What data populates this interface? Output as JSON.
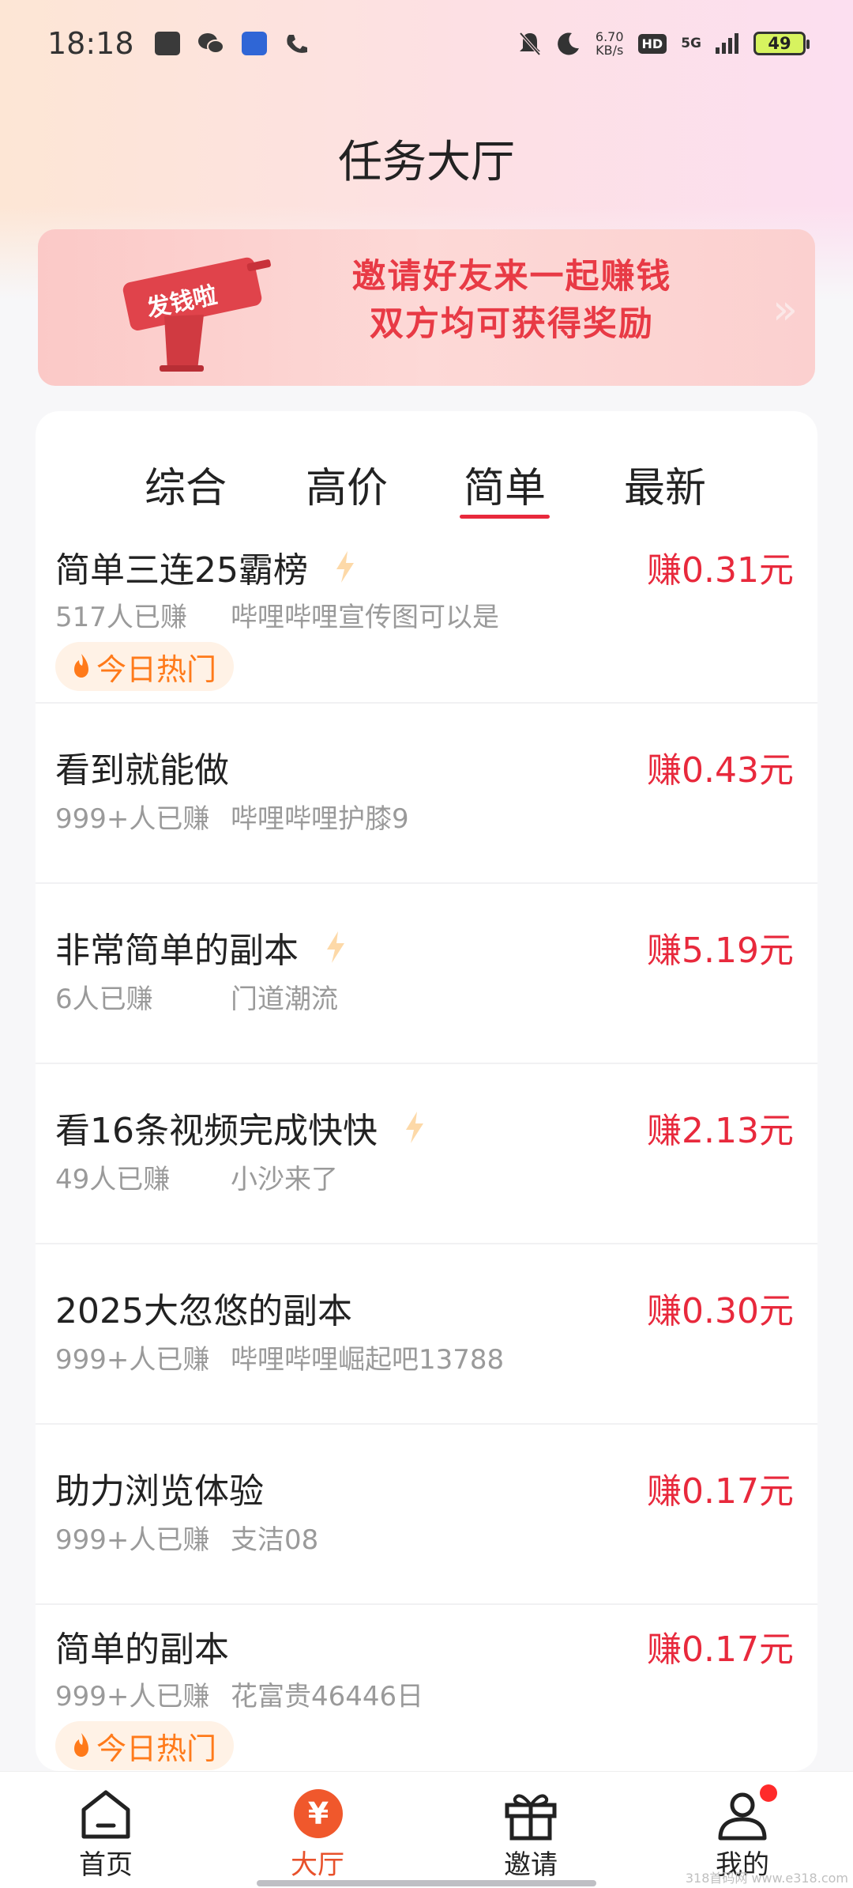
{
  "status_bar": {
    "time": "18:18",
    "net_speed_value": "6.70",
    "net_speed_unit": "KB/s",
    "hd": "HD",
    "network": "5G",
    "battery": "49",
    "icons": [
      "calendar-icon",
      "wechat-icon",
      "baidu-icon",
      "missed-call-icon",
      "mute-icon",
      "moon-icon",
      "signal-icon"
    ]
  },
  "header": {
    "title": "任务大厅"
  },
  "banner": {
    "badge": "发钱啦",
    "line1": "邀请好友来一起赚钱",
    "line2": "双方均可获得奖励",
    "arrow": "»"
  },
  "tabs": [
    {
      "label": "综合",
      "active": false
    },
    {
      "label": "高价",
      "active": false
    },
    {
      "label": "简单",
      "active": true
    },
    {
      "label": "最新",
      "active": false
    }
  ],
  "tasks": [
    {
      "title": "简单三连25霸榜",
      "lightning": true,
      "reward": "赚0.31元",
      "count": "517人已赚",
      "author": "哔哩哔哩宣传图可以是",
      "hot": "今日热门"
    },
    {
      "title": "看到就能做",
      "lightning": false,
      "reward": "赚0.43元",
      "count": "999+人已赚",
      "author": "哔哩哔哩护膝9",
      "hot": ""
    },
    {
      "title": "非常简单的副本",
      "lightning": true,
      "reward": "赚5.19元",
      "count": "6人已赚",
      "author": "门道潮流",
      "hot": ""
    },
    {
      "title": "看16条视频完成快快",
      "lightning": true,
      "reward": "赚2.13元",
      "count": "49人已赚",
      "author": "小沙来了",
      "hot": ""
    },
    {
      "title": "2025大忽悠的副本",
      "lightning": false,
      "reward": "赚0.30元",
      "count": "999+人已赚",
      "author": "哔哩哔哩崛起吧13788",
      "hot": ""
    },
    {
      "title": "助力浏览体验",
      "lightning": false,
      "reward": "赚0.17元",
      "count": "999+人已赚",
      "author": "支洁08",
      "hot": ""
    },
    {
      "title": "简单的副本",
      "lightning": false,
      "reward": "赚0.17元",
      "count": "999+人已赚",
      "author": "花富贵46446日",
      "hot": "今日热门"
    }
  ],
  "bottom_nav": [
    {
      "label": "首页",
      "icon": "home-icon",
      "active": false
    },
    {
      "label": "大厅",
      "icon": "yen-icon",
      "active": true,
      "icon_text": "¥"
    },
    {
      "label": "邀请",
      "icon": "gift-icon",
      "active": false
    },
    {
      "label": "我的",
      "icon": "user-icon",
      "active": false
    }
  ],
  "watermark": "318首码网 www.e318.com",
  "colors": {
    "accent": "#e8293c",
    "hot": "#ff7a1a",
    "nav_active": "#f0582c"
  }
}
